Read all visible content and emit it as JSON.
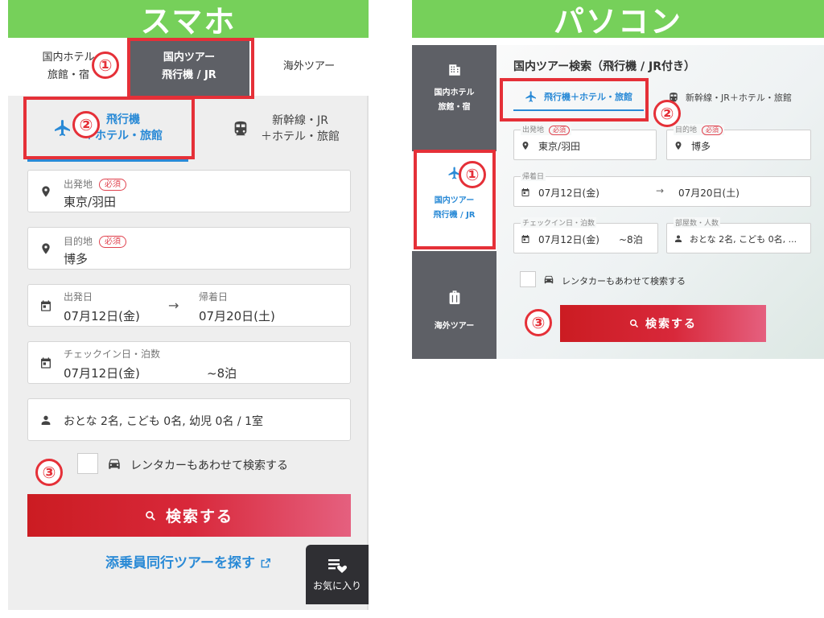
{
  "smartphone": {
    "header": "スマホ",
    "tabs": [
      {
        "line1": "国内ホテル",
        "line2": "旅館・宿"
      },
      {
        "line1": "国内ツアー",
        "line2": "飛行機 / JR"
      },
      {
        "line1": "海外ツアー",
        "line2": ""
      }
    ],
    "modes": [
      {
        "line1": "飛行機",
        "line2": "＋ホテル・旅館"
      },
      {
        "line1": "新幹線・JR",
        "line2": "＋ホテル・旅館"
      }
    ],
    "departure": {
      "label": "出発地",
      "required": "必須",
      "value": "東京/羽田"
    },
    "destination": {
      "label": "目的地",
      "required": "必須",
      "value": "博多"
    },
    "dates": {
      "depart_label": "出発日",
      "depart_value": "07月12日(金)",
      "arrow": "→",
      "return_label": "帰着日",
      "return_value": "07月20日(土)"
    },
    "checkin": {
      "label": "チェックイン日・泊数",
      "date": "07月12日(金)",
      "nights": "~8泊"
    },
    "guests": {
      "value": "おとな 2名, こども 0名, 幼児 0名 / 1室"
    },
    "rental_car": "レンタカーもあわせて検索する",
    "search_button": "検索する",
    "escort_link": "添乗員同行ツアーを探す",
    "favorites": "お気に入り"
  },
  "pc": {
    "header": "パソコン",
    "sidebar": [
      {
        "line1": "国内ホテル",
        "line2": "旅館・宿"
      },
      {
        "line1": "国内ツアー",
        "line2": "飛行機 / JR"
      },
      {
        "line1": "海外ツアー",
        "line2": ""
      }
    ],
    "title": "国内ツアー検索（飛行機 / JR付き）",
    "modes": [
      "飛行機＋ホテル・旅館",
      "新幹線・JR＋ホテル・旅館"
    ],
    "departure": {
      "label": "出発地",
      "required": "必須",
      "value": "東京/羽田"
    },
    "destination": {
      "label": "目的地",
      "required": "必須",
      "value": "博多"
    },
    "dates": {
      "label": "帰着日",
      "depart": "07月12日(金)",
      "arrow": "→",
      "return": "07月20日(土)"
    },
    "checkin": {
      "label": "チェックイン日・泊数",
      "date": "07月12日(金)",
      "nights": "~8泊"
    },
    "rooms": {
      "label": "部屋数・人数",
      "value": "おとな 2名, こども 0名, ..."
    },
    "rental_car": "レンタカーもあわせて検索する",
    "search_button": "検索する"
  },
  "annotations": [
    "①",
    "②",
    "③"
  ],
  "colors": {
    "header_green": "#76d05a",
    "accent_blue": "#2a8ad6",
    "search_red": "#cb1c22",
    "annotation_red": "#e53038"
  }
}
